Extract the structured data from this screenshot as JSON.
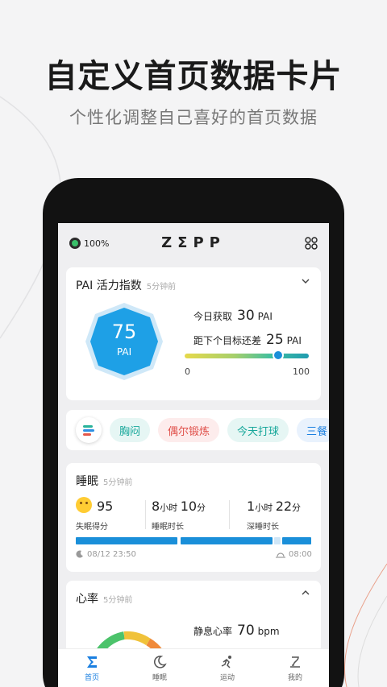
{
  "promo": {
    "title": "自定义首页数据卡片",
    "subtitle": "个性化调整自己喜好的首页数据"
  },
  "status": {
    "battery": "100%",
    "logo": "ZΣPP"
  },
  "pai": {
    "title": "PAI 活力指数",
    "time": "5分钟前",
    "value": "75",
    "badge_label": "PAI",
    "today_label": "今日获取",
    "today_value": "30",
    "today_unit": "PAI",
    "goal_label": "距下个目标还差",
    "goal_value": "25",
    "goal_unit": "PAI",
    "bar_min": "0",
    "bar_max": "100",
    "progress": 75
  },
  "tags": {
    "items": [
      "胸闷",
      "偶尔锻炼",
      "今天打球",
      "三餐"
    ]
  },
  "sleep": {
    "title": "睡眠",
    "time": "5分钟前",
    "score": "95",
    "score_label": "失眠得分",
    "hours": "8",
    "hours_unit": "小时",
    "minutes": "10",
    "minutes_unit": "分",
    "duration_label": "睡眠时长",
    "deep_hours": "1",
    "deep_hours_unit": "小时",
    "deep_minutes": "22",
    "deep_minutes_unit": "分",
    "deep_label": "深睡时长",
    "start": "08/12 23:50",
    "end": "08:00"
  },
  "heart": {
    "title": "心率",
    "time": "5分钟前",
    "resting_label": "静息心率",
    "resting_value": "70",
    "resting_unit": "bpm"
  },
  "nav": {
    "items": [
      {
        "label": "首页",
        "icon": "sigma-icon",
        "active": true
      },
      {
        "label": "睡眠",
        "icon": "moon-icon",
        "active": false
      },
      {
        "label": "运动",
        "icon": "run-icon",
        "active": false
      },
      {
        "label": "我的",
        "icon": "profile-icon",
        "active": false
      }
    ]
  },
  "colors": {
    "accent": "#1a7fe0",
    "pai_badge": "#1ea0e6",
    "tag_teal": "#17a79a",
    "tag_red": "#e0504a",
    "sleep_bar": "#1a8fd9"
  }
}
